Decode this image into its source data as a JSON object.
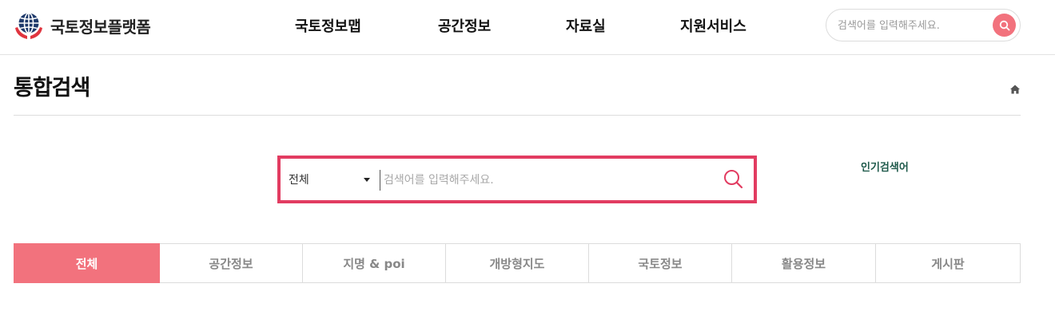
{
  "header": {
    "logo_text": "국토정보플랫폼",
    "nav": [
      "국토정보맵",
      "공간정보",
      "자료실",
      "지원서비스"
    ],
    "search_placeholder": "검색어를 입력해주세요."
  },
  "page": {
    "title": "통합검색"
  },
  "search": {
    "scope_selected": "전체",
    "placeholder": "검색어를 입력해주세요.",
    "popular_label": "인기검색어"
  },
  "tabs": [
    {
      "label": "전체",
      "active": true
    },
    {
      "label": "공간정보",
      "active": false
    },
    {
      "label": "지명 & poi",
      "active": false
    },
    {
      "label": "개방형지도",
      "active": false
    },
    {
      "label": "국토정보",
      "active": false
    },
    {
      "label": "활용정보",
      "active": false
    },
    {
      "label": "게시판",
      "active": false
    }
  ],
  "colors": {
    "accent": "#f2727d",
    "search_border": "#e23c61",
    "popular_text": "#1f5a4b",
    "logo_navy": "#1f3a6b",
    "logo_red": "#e0353f"
  },
  "icons": {
    "logo": "globe-hands-icon",
    "top_search": "search-icon",
    "home": "home-icon",
    "main_search": "search-icon",
    "scope_caret": "caret-down-icon"
  }
}
